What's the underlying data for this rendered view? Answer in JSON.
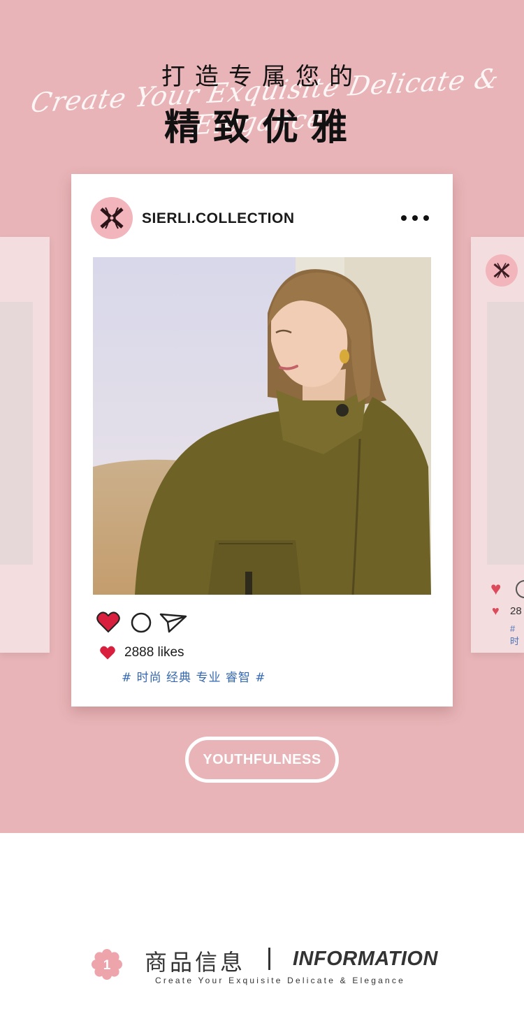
{
  "header": {
    "title_line1": "打造专属您的",
    "script_line": "Create Your Exquisite Delicate & Elegance",
    "title_line2": "精致优雅"
  },
  "post": {
    "account_name": "SIERLI.COLLECTION",
    "likes": "2888 likes",
    "tags": "# 时尚 经典 专业 睿智 #",
    "liked": true
  },
  "side_card_right": {
    "likes": "28",
    "tags": "# 时"
  },
  "button": {
    "label": "YOUTHFULNESS"
  },
  "info": {
    "badge_number": "1",
    "title_cn": "商品信息",
    "title_en": "INFORMATION",
    "subtitle": "Create Your Exquisite Delicate & Elegance"
  },
  "colors": {
    "pink_background": "#e8b4b7",
    "avatar_pink": "#f1b5bb",
    "heart_red": "#d81f3d",
    "tag_blue": "#3568b0"
  },
  "icons": [
    "logo-icon",
    "more-icon",
    "heart-icon",
    "comment-icon",
    "share-icon",
    "heart-small-icon",
    "flower-badge-icon"
  ]
}
